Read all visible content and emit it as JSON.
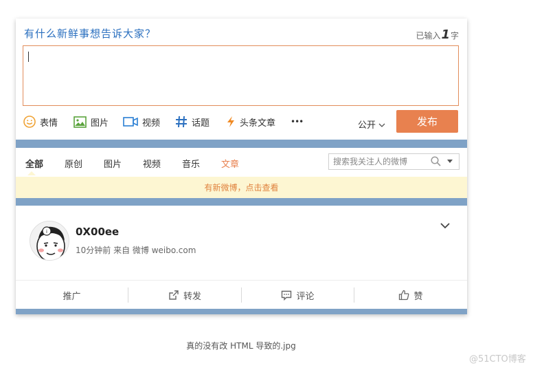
{
  "publisher": {
    "prompt": "有什么新鲜事想告诉大家？",
    "count_prefix": "已输入",
    "count_value": "1",
    "count_suffix": "字",
    "textarea_value": "",
    "tools": [
      {
        "label": "表情",
        "icon": "smile-icon"
      },
      {
        "label": "图片",
        "icon": "image-icon"
      },
      {
        "label": "视频",
        "icon": "video-icon"
      },
      {
        "label": "话题",
        "icon": "hashtag-icon"
      },
      {
        "label": "头条文章",
        "icon": "lightning-icon"
      },
      {
        "label": "•••",
        "icon": "more-icon"
      }
    ],
    "visibility": "公开",
    "submit_label": "发布"
  },
  "feed_tabs": {
    "items": [
      "全部",
      "原创",
      "图片",
      "视频",
      "音乐",
      "文章"
    ],
    "active": "全部",
    "search_placeholder": "搜索我关注人的微博"
  },
  "notice": "有新微博，点击查看",
  "post": {
    "username": "0X00ee",
    "meta": "10分钟前 来自 微博 weibo.com",
    "actions": [
      {
        "label": "推广",
        "icon": ""
      },
      {
        "label": "转发",
        "icon": "share-icon"
      },
      {
        "label": "评论",
        "icon": "comment-icon"
      },
      {
        "label": "赞",
        "icon": "thumbs-up-icon"
      }
    ]
  },
  "caption": "真的没有改 HTML 导致的.jpg",
  "watermark": "@51CTO博客",
  "colors": {
    "accent": "#e8814f",
    "prompt_blue": "#2a6fbf",
    "band_blue": "#7fa2c6",
    "notice_bg": "#fdf6d2",
    "notice_text": "#e0823e"
  }
}
